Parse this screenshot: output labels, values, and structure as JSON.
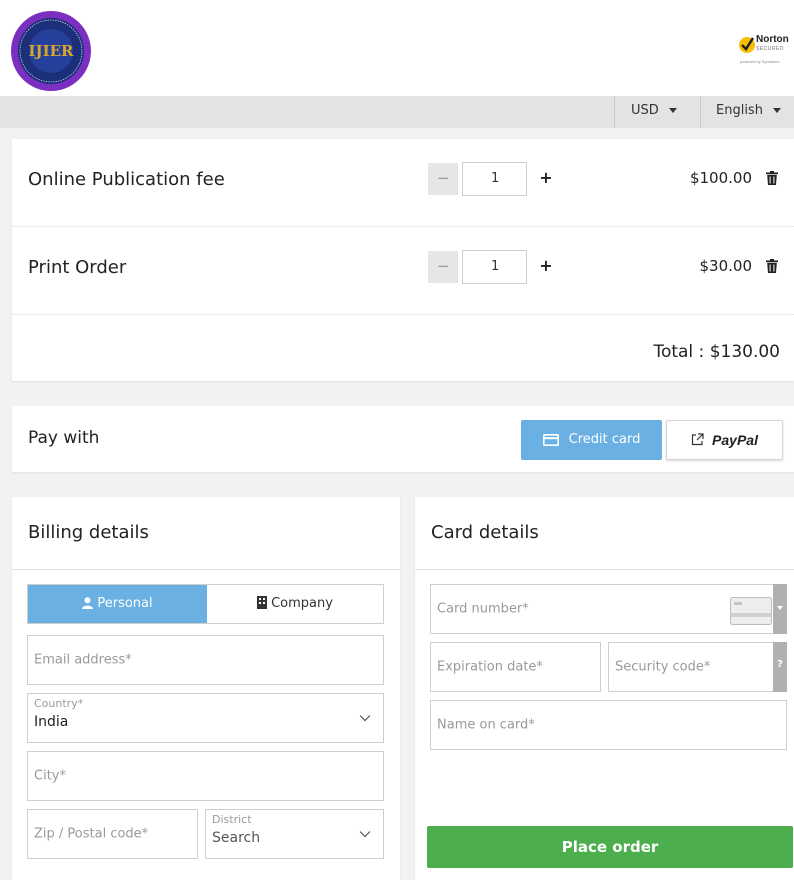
{
  "header": {
    "logo_text": "IJIER",
    "norton": {
      "brand": "Norton",
      "secured": "SECURED",
      "powered": "powered by Symantec"
    }
  },
  "topbar": {
    "currency": "USD",
    "language": "English"
  },
  "cart": {
    "items": [
      {
        "name": "Online Publication fee",
        "qty": "1",
        "price": "$100.00"
      },
      {
        "name": "Print Order",
        "qty": "1",
        "price": "$30.00"
      }
    ],
    "minus_label": "−",
    "plus_label": "+",
    "total": "Total : $130.00"
  },
  "pay": {
    "label": "Pay with",
    "credit_card": "Credit card",
    "paypal": "PayPal"
  },
  "billing": {
    "title": "Billing details",
    "tab_personal": "Personal",
    "tab_company": "Company",
    "email_placeholder": "Email address*",
    "country_label": "Country*",
    "country_value": "India",
    "city_placeholder": "City*",
    "zip_placeholder": "Zip / Postal code*",
    "district_label": "District",
    "district_value": "Search"
  },
  "card_details": {
    "title": "Card details",
    "card_number_placeholder": "Card number*",
    "expiration_placeholder": "Expiration date*",
    "security_placeholder": "Security code*",
    "security_help": "?",
    "name_placeholder": "Name on card*"
  },
  "place_order": "Place order",
  "colors": {
    "accent_blue": "#6ab0e2",
    "place_order_green": "#4cae4c",
    "logo_purple": "#7b2fc0"
  }
}
